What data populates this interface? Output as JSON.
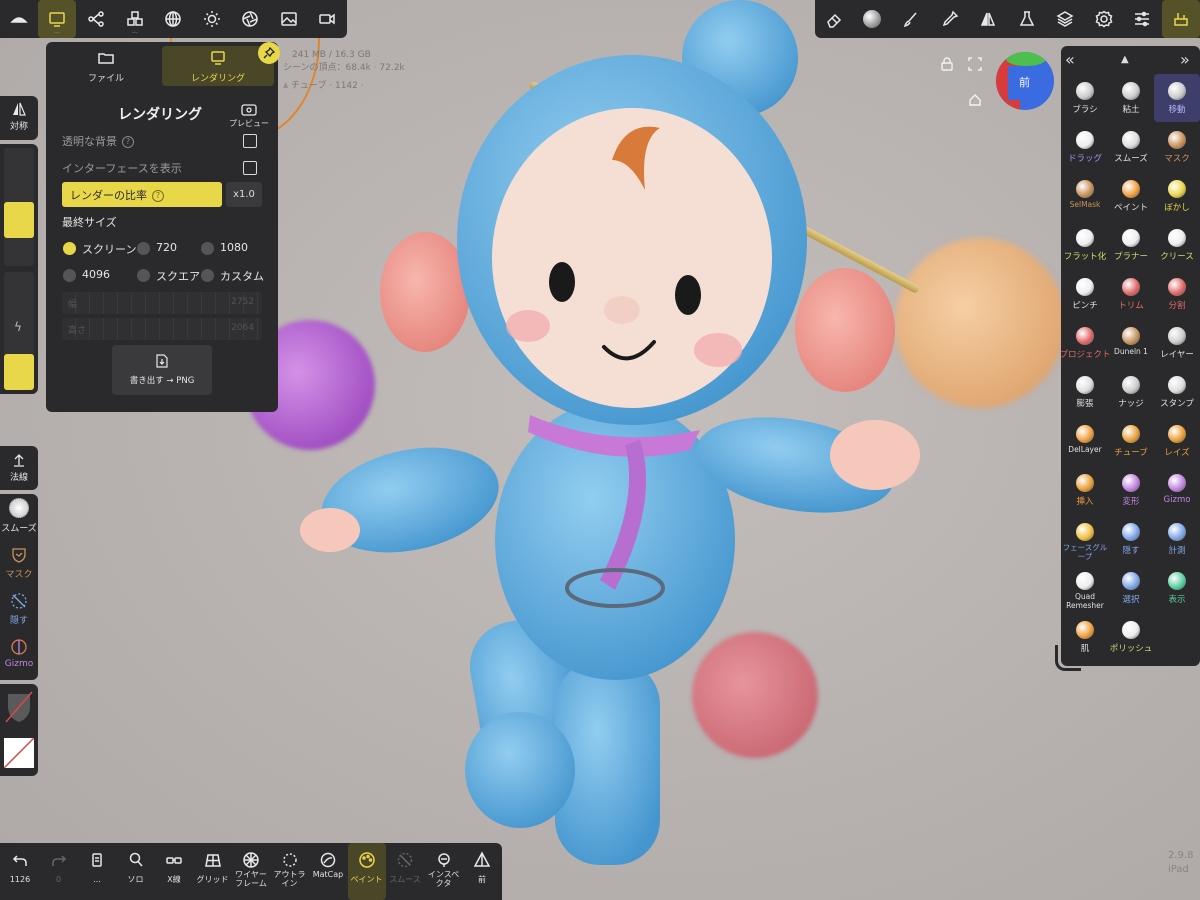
{
  "top_toolbar_left": [
    {
      "name": "logo",
      "icon": "nomad-logo-icon"
    },
    {
      "name": "render",
      "icon": "monitor-icon",
      "active": true
    },
    {
      "name": "scene",
      "icon": "scene-graph-icon"
    },
    {
      "name": "topology",
      "icon": "cubes-icon"
    },
    {
      "name": "material",
      "icon": "sphere-grid-icon"
    },
    {
      "name": "light",
      "icon": "sun-icon"
    },
    {
      "name": "shading",
      "icon": "aperture-icon"
    },
    {
      "name": "background",
      "icon": "image-icon"
    },
    {
      "name": "camera",
      "icon": "video-camera-icon"
    }
  ],
  "top_toolbar_right": [
    {
      "name": "eraser",
      "icon": "eraser-icon"
    },
    {
      "name": "material-ball",
      "icon": "material-ball-icon"
    },
    {
      "name": "brush",
      "icon": "brush-icon"
    },
    {
      "name": "picker",
      "icon": "picker-icon"
    },
    {
      "name": "symmetry",
      "icon": "symmetry-icon"
    },
    {
      "name": "flask",
      "icon": "flask-icon"
    },
    {
      "name": "layers",
      "icon": "layers-icon"
    },
    {
      "name": "settings",
      "icon": "gear-icon"
    },
    {
      "name": "sliders",
      "icon": "sliders-icon"
    },
    {
      "name": "stroke-tools",
      "icon": "tools-icon",
      "active": true
    }
  ],
  "render_panel": {
    "tab_file": "ファイル",
    "tab_render": "レンダリング",
    "title": "レンダリング",
    "preview_label": "プレビュー",
    "transparent_bg": "透明な背景",
    "show_interface": "インターフェースを表示",
    "render_ratio": "レンダーの比率",
    "ratio_value": "x1.0",
    "final_size": "最終サイズ",
    "options": [
      "スクリーン",
      "720",
      "1080",
      "4096",
      "スクエア",
      "カスタム"
    ],
    "width_label": "幅",
    "width_value": "2752",
    "height_label": "高さ",
    "height_value": "2064",
    "export_label": "書き出す → PNG",
    "help_mark": "?"
  },
  "stats": {
    "memory": "241 MB / 16.3 GB",
    "scene_vertices": "シーンの頂点：68.4k · 72.2k",
    "tube": "チューブ · 1142 ·"
  },
  "gizmo_label": "前",
  "left_strip": {
    "symmetry": "対称",
    "normal": "法線",
    "smooth": "スムーズ",
    "mask": "マスク",
    "hide": "隠す",
    "gizmo": "Gizmo"
  },
  "tools": [
    {
      "label": "ブラシ",
      "color": "#e0e0e0"
    },
    {
      "label": "粘土",
      "color": "#e0e0e0"
    },
    {
      "label": "移動",
      "color": "#e0e0e0",
      "active": true
    },
    {
      "label": "ドラッグ",
      "color": "#a58ff2"
    },
    {
      "label": "スムーズ",
      "color": "#e0e0e0"
    },
    {
      "label": "マスク",
      "color": "#c8935c"
    },
    {
      "label": "SelMask",
      "color": "#c8935c"
    },
    {
      "label": "ペイント",
      "color": "#e0e0e0"
    },
    {
      "label": "ぼかし",
      "color": "#e9d74a"
    },
    {
      "label": "フラット化",
      "color": "#c6e06a"
    },
    {
      "label": "プラナー",
      "color": "#c6e06a"
    },
    {
      "label": "クリース",
      "color": "#c6e06a"
    },
    {
      "label": "ピンチ",
      "color": "#e0e0e0"
    },
    {
      "label": "トリム",
      "color": "#e06a6a"
    },
    {
      "label": "分割",
      "color": "#e06a6a"
    },
    {
      "label": "プロジェクト",
      "color": "#e06a6a"
    },
    {
      "label": "Duneln 1",
      "color": "#e0e0e0"
    },
    {
      "label": "レイヤー",
      "color": "#e0e0e0"
    },
    {
      "label": "膨張",
      "color": "#e0e0e0"
    },
    {
      "label": "ナッジ",
      "color": "#e0e0e0"
    },
    {
      "label": "スタンプ",
      "color": "#e0e0e0"
    },
    {
      "label": "DelLayer",
      "color": "#e0e0e0"
    },
    {
      "label": "チューブ",
      "color": "#e9a03a"
    },
    {
      "label": "レイズ",
      "color": "#e9a03a"
    },
    {
      "label": "挿入",
      "color": "#e9a03a"
    },
    {
      "label": "変形",
      "color": "#c085e0"
    },
    {
      "label": "Gizmo",
      "color": "#c085e0"
    },
    {
      "label": "フェースグループ",
      "color": "#7fa8e8"
    },
    {
      "label": "隠す",
      "color": "#7fa8e8"
    },
    {
      "label": "計測",
      "color": "#7fa8e8"
    },
    {
      "label": "Quad Remesher",
      "color": "#e0e0e0"
    },
    {
      "label": "選択",
      "color": "#7fa8e8"
    },
    {
      "label": "表示",
      "color": "#5ad0a0"
    },
    {
      "label": "肌",
      "color": "#e0e0e0"
    },
    {
      "label": "ポリッシュ",
      "color": "#c6e06a"
    }
  ],
  "bottom_bar": [
    {
      "label": "1126",
      "icon": "undo-icon"
    },
    {
      "label": "0",
      "icon": "redo-icon",
      "disabled": true
    },
    {
      "label": "...",
      "icon": "history-icon"
    },
    {
      "label": "ソロ",
      "icon": "search-icon"
    },
    {
      "label": "X線",
      "icon": "glasses-icon"
    },
    {
      "label": "グリッド",
      "icon": "grid-icon"
    },
    {
      "label": "ワイヤーフレーム",
      "icon": "wireframe-icon"
    },
    {
      "label": "アウトライン",
      "icon": "outline-icon"
    },
    {
      "label": "MatCap",
      "icon": "matcap-icon"
    },
    {
      "label": "ペイント",
      "icon": "palette-icon",
      "active": true
    },
    {
      "label": "スムース",
      "icon": "smooth-icon",
      "disabled": true
    },
    {
      "label": "インスペクタ",
      "icon": "inspector-icon"
    },
    {
      "label": "前",
      "icon": "view-icon"
    }
  ],
  "version": "2.9.8",
  "device": "iPad"
}
